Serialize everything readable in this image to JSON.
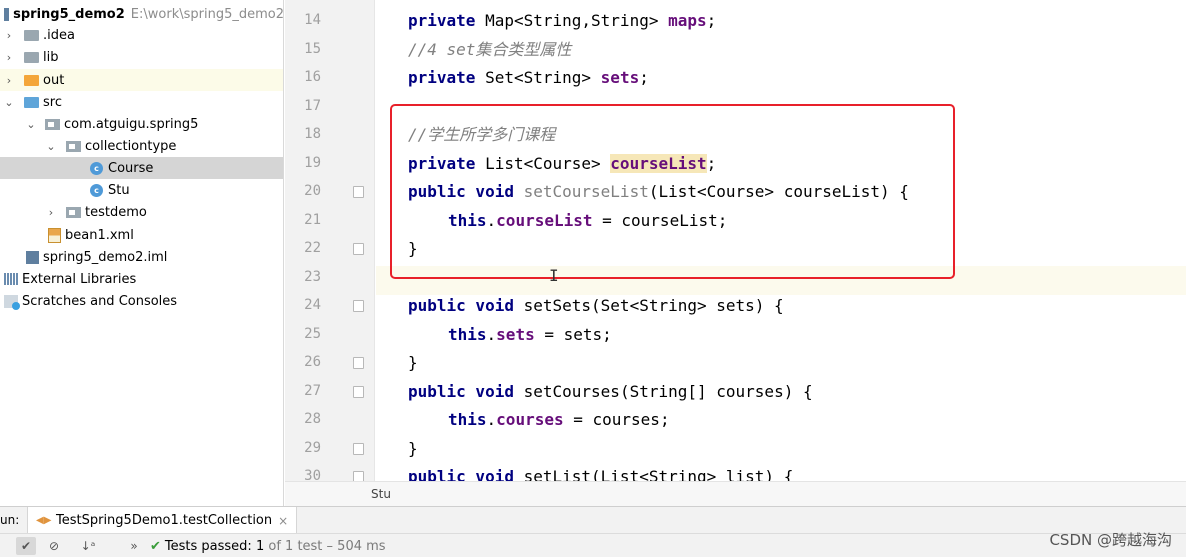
{
  "project": {
    "name": "spring5_demo2",
    "path": "E:\\work\\spring5_demo2",
    "items": [
      {
        "label": "spring5_demo2",
        "path": "E:\\work\\spring5_demo2"
      },
      {
        "label": ".idea"
      },
      {
        "label": "lib"
      },
      {
        "label": "out"
      },
      {
        "label": "src"
      },
      {
        "label": "com.atguigu.spring5"
      },
      {
        "label": "collectiontype"
      },
      {
        "label": "Course"
      },
      {
        "label": "Stu"
      },
      {
        "label": "testdemo"
      },
      {
        "label": "bean1.xml"
      },
      {
        "label": "spring5_demo2.iml"
      },
      {
        "label": "External Libraries"
      },
      {
        "label": "Scratches and Consoles"
      }
    ]
  },
  "editor": {
    "line_numbers": [
      "14",
      "15",
      "16",
      "17",
      "18",
      "19",
      "20",
      "21",
      "22",
      "23",
      "24",
      "25",
      "26",
      "27",
      "28",
      "29",
      "30"
    ],
    "lines": [
      {
        "kw": "private",
        "rest": " Map<String,String> ",
        "field": "maps",
        "tail": ";"
      },
      {
        "comment": "//4 set集合类型属性"
      },
      {
        "kw": "private",
        "rest": " Set<String> ",
        "field": "sets",
        "tail": ";"
      },
      {},
      {
        "comment": "//学生所学多门课程"
      },
      {
        "kw": "private",
        "rest": " List<Course> ",
        "field": "courseList",
        "tail": ";"
      },
      {
        "kw": "public void",
        "method": " setCourseList",
        "tail": "(List<Course> courseList) {"
      },
      {
        "kw": "this",
        "dot": ".",
        "field": "courseList",
        "tail": " = courseList;"
      },
      {
        "tail": "}"
      },
      {},
      {
        "kw": "public void",
        "method": " setSets",
        "tail": "(Set<String> sets) {"
      },
      {
        "kw": "this",
        "dot": ".",
        "field": "sets",
        "tail": " = sets;"
      },
      {
        "tail": "}"
      },
      {
        "kw": "public void",
        "method": " setCourses",
        "tail": "(String[] courses) {"
      },
      {
        "kw": "this",
        "dot": ".",
        "field": "courses",
        "tail": " = courses;"
      },
      {
        "tail": "}"
      },
      {
        "kw": "public void",
        "method": " setList",
        "tail": "(List<String> list) {"
      }
    ],
    "cursor": "I"
  },
  "breadcrumb": "Stu",
  "run": {
    "label": "un:",
    "tab_title": "TestSpring5Demo1.testCollection",
    "tab_close": "×",
    "status_prefix": "Tests passed:",
    "status_count": "1",
    "status_suffix": "of 1 test – 504 ms"
  },
  "watermark": "CSDN @跨越海沟",
  "colors": {
    "keyword": "#000080",
    "field": "#660e7a",
    "comment": "#808080",
    "highlight_box": "#e8202a",
    "pass": "#3a9d3a"
  }
}
